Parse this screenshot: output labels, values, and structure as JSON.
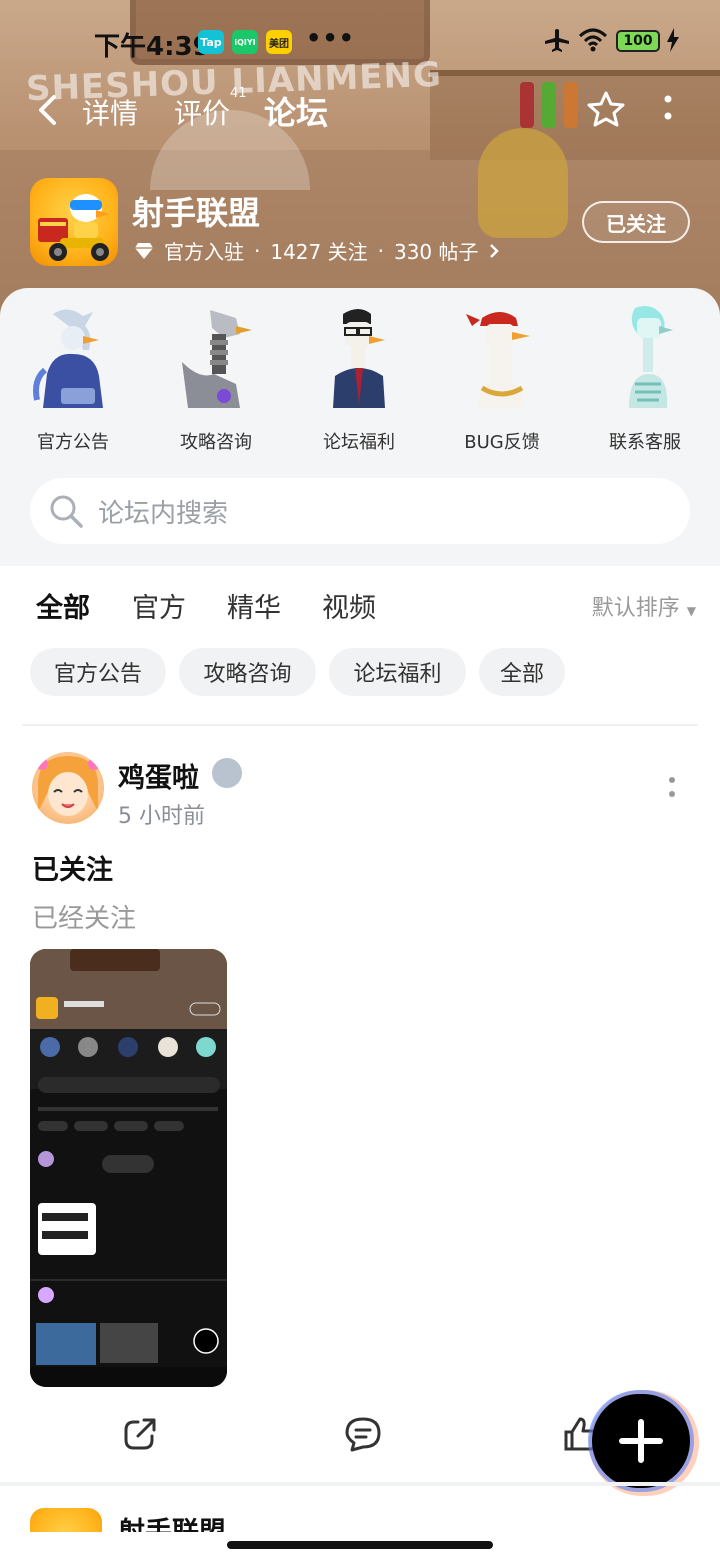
{
  "status_bar": {
    "time": "下午4:39",
    "apps": [
      "Tap",
      "iQIYI",
      "美团"
    ],
    "battery": "100"
  },
  "banner": {
    "watermark": "SHESHOU LIANMENG"
  },
  "nav": {
    "tabs": [
      {
        "label": "详情",
        "active": false
      },
      {
        "label": "评价",
        "active": false,
        "badge": "41"
      },
      {
        "label": "论坛",
        "active": true
      }
    ]
  },
  "game": {
    "title": "射手联盟",
    "official_label": "官方入驻",
    "followers": "1427 关注",
    "posts": "330 帖子",
    "follow_button": "已关注"
  },
  "categories": [
    {
      "label": "官方公告"
    },
    {
      "label": "攻略咨询"
    },
    {
      "label": "论坛福利"
    },
    {
      "label": "BUG反馈"
    },
    {
      "label": "联系客服"
    }
  ],
  "search": {
    "placeholder": "论坛内搜索"
  },
  "forum_tabs": [
    {
      "label": "全部",
      "active": true
    },
    {
      "label": "官方",
      "active": false
    },
    {
      "label": "精华",
      "active": false
    },
    {
      "label": "视频",
      "active": false
    }
  ],
  "sort_label": "默认排序",
  "chips": [
    "官方公告",
    "攻略咨询",
    "论坛福利",
    "全部"
  ],
  "post": {
    "author": "鸡蛋啦",
    "time": "5 小时前",
    "title": "已关注",
    "body": "已经关注"
  },
  "next_post": {
    "author": "射手联盟"
  },
  "colors": {
    "accent": "#19d2c0",
    "chip_bg": "#f1f2f3",
    "panel_bg": "#f4f5f6"
  }
}
